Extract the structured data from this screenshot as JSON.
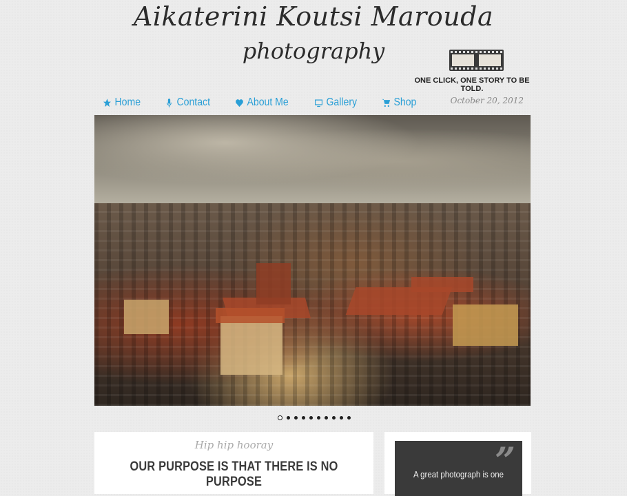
{
  "header": {
    "title": "Aikaterini Koutsi Marouda",
    "subtitle": "photography",
    "tagline": "ONE CLICK, ONE STORY TO BE TOLD.",
    "logo_icon": "film-strip-icon"
  },
  "nav": {
    "items": [
      {
        "label": "Home",
        "icon": "star-icon"
      },
      {
        "label": "Contact",
        "icon": "microphone-icon"
      },
      {
        "label": "About Me",
        "icon": "heart-icon"
      },
      {
        "label": "Gallery",
        "icon": "monitor-icon"
      },
      {
        "label": "Shop",
        "icon": "cart-icon"
      }
    ],
    "color": "#2a9fd6"
  },
  "date": "October 20, 2012",
  "slider": {
    "slide_count": 10,
    "active_index": 0
  },
  "article": {
    "kicker": "Hip hip hooray",
    "headline": "OUR PURPOSE IS THAT THERE IS NO PURPOSE"
  },
  "quote": {
    "mark": "”",
    "text": "A great photograph is one"
  }
}
